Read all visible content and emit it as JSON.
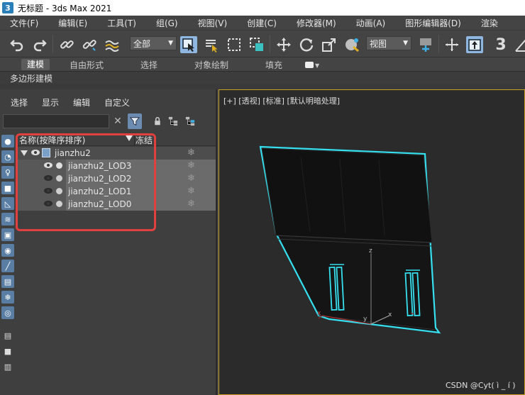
{
  "window": {
    "title": "无标题 - 3ds Max 2021",
    "app_icon_label": "3"
  },
  "menubar": {
    "items": [
      "文件(F)",
      "编辑(E)",
      "工具(T)",
      "组(G)",
      "视图(V)",
      "创建(C)",
      "修改器(M)",
      "动画(A)",
      "图形编辑器(D)",
      "渲染"
    ]
  },
  "toolbar": {
    "selection_filter": "全部",
    "reference_coord": "视图",
    "snap_label": "3"
  },
  "ribbon": {
    "tabs": [
      "建模",
      "自由形式",
      "选择",
      "对象绘制",
      "填充"
    ],
    "active_tab": "建模",
    "sub_label": "多边形建模"
  },
  "scene_explorer": {
    "menu": [
      "选择",
      "显示",
      "编辑",
      "自定义"
    ],
    "search_placeholder": "",
    "columns": {
      "name": "名称(按降序排序)",
      "freeze": "冻结"
    },
    "root": {
      "name": "jianzhu2",
      "expanded": true
    },
    "children": [
      {
        "name": "jianzhu2_LOD3",
        "visible": true
      },
      {
        "name": "jianzhu2_LOD2",
        "visible": false
      },
      {
        "name": "jianzhu2_LOD1",
        "visible": false
      },
      {
        "name": "jianzhu2_LOD0",
        "visible": false
      }
    ],
    "freeze_glyph": "❄"
  },
  "viewport": {
    "label": "[+] [透视] [标准] [默认明暗处理]",
    "selection_color": "#35e0f0",
    "axis_labels": [
      "z",
      "x",
      "y",
      "x"
    ]
  },
  "watermark": "CSDN @Cyt( ì _ í )",
  "colors": {
    "highlight_annotation": "#e04040",
    "active_button": "#8fb7e0",
    "panel_bg": "#3f3f3f"
  }
}
